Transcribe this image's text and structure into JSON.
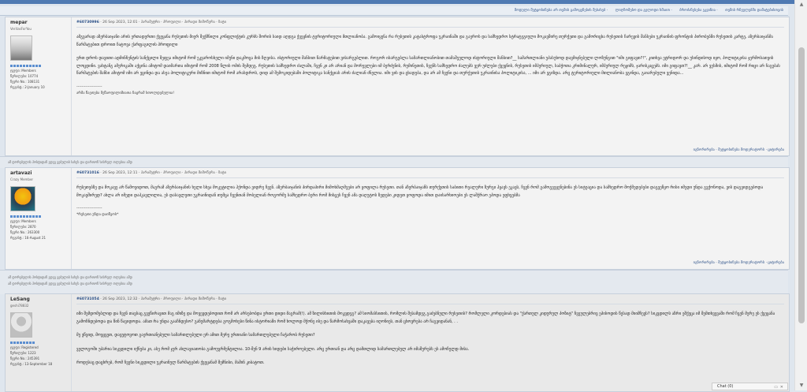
{
  "toplinks": [
    "მოდული შეტყობინება არ თემის გამოყენების შესახებ",
    "ლიღზომებო და გელოდი ხმაით",
    "ბროძანესება ეკვინია",
    "თემის რჩეულებში დამატებისთვის"
  ],
  "posts": [
    {
      "username": "mepar",
      "user_title": "VeritasForYou",
      "stats": [
        "ჯგუფი: Members",
        "წერილები: 10774",
        "წევრი No.: 108131",
        "რეგისტ.: 2-January 10"
      ],
      "header_id": "#60730996",
      "header_rest": " · 26 Sep 2023, 12:01 · პარამეტრი · პროფილი · პირადი მიმოწერა · ზატი",
      "paragraphs": [
        "ამგვარად აზერბაიჯანი არის ერთადერთი ქვეყანა რუსეთის მიერ შექმნილი კონფლიქტის კურსს შორის საიდ აღდგა ქვეყნის ტერიტორიული მთლიანობა. გამოიყენა რა რუსეთის კატასტროფა უკრაინაში და გაეროს და სამხედრო სტრატეგიული მოკავშირე თურქეთი და გამორიცხა რუსეთის ჩარევის შანსები უკრაინის ფრონტის პირობებში რუსეთის კარტე, აზერბაიჯანმა წარმატებით დროით ჩატოვა ქარფაგილის პროფილი",
        "ერთ დროს დავითი ადმინჩენტის სანქცილი შეფეა იმიტომ რომ ეკვაროსხელი იმენი დაკმოცა მის ზღვისა. ისტორიული შანსით წარმატებით ვისარგებლით. როგორ ისარგებლა სამართლიანობით თამაშეულოდ ისტორიული შანსით?__ სამართლიანი უპასუხოდ დავმიჯნებული ლოზუნგით \"იმი გიფავთ?!\", კითხვა ეტრიდორ და უსინდისოდ იყო, პოლიტიკისა ჯერმოსათვის ლოცდინი. ვახტანგ ამერიკაში აქცინა ამიტომ დაიმართა იმიტომ რომ 2008 წლის ომის შემდეგ. რუსეთის სამხედრო ძალაში, ჩვენ კი არ არიან და მორევლები იმ ბერძენის, რუმინეთის, ჩვენს სამხედრო ძალებს ვერ უძლები ქვეყნის, რუსეთის იმპერიულ, საბჭოთა კრიმინალურ, იმპერიულ რეჟიმს, ჯარისკაცებს. იმი გიფავთ?!__ კარ. არ ვესმის, იმიტომ რომ რიცი არ ჩაგებას წარმატების შანსი ამიტომ იმი არ ეცინდა და ასეა პოლიტიკური მიზნით იმიტომ რომ არასდროს, დიდ ამ შემოკიდებაში პოლიტიკა სანქციას არის ძალიან ძნელია. იმი ვის და ცხადება, და არ ამ ჩვენი და თურქეთის უკრაინისა პოლიტიკისა, ... იმი არ ვგიზდა. არც ტერიტორიული მთლიანობა ვგინდა, გაიარებული ვენიდა..."
      ],
      "sig_dashes": "--------------------",
      "signature": "არმა წაეთება მეწაოფილიმიათა ჩაცრამ სთოლდებულია!",
      "footer": [
        "იგნორირება",
        "შეტყობინება მოდერატორს",
        "ციტირება"
      ]
    },
    {
      "username": "artavazi",
      "user_title": "Crazy Member",
      "stats": [
        "ჯგუფი: Members",
        "წერილები: 2870",
        "წევრი No.: 263300",
        "რეგისტ.: 16-August 21"
      ],
      "header_id": "#60731016",
      "header_rest": " · 26 Sep 2023, 12:11 · პარამეტრი · პროფილი · პირადი მიმოწერა · ზატი",
      "paragraphs": [
        "რუსეთებზე და მოკავე არ წამოვიდოთ, მაგრამ აზერბაიჯანის ხელი სხვა მოკეტილია ჰქონდა ვიდრე ჩვენ. აზერბაიჯანის პირდაპირი მიმოხმაღმეები არ ყოფილა რუსეთი. თან აზერბაიჯანს თურქეთის საბითი რეალური ზურგი ჰყავს ეკავს, ჩვენ რომ გამოგვეყენებინა ეს სიტუაცია და სამხედრო მოქმედებები დაგვეწყო რისი იმედი უნდა გვქონოდა, ვის დაგვიდგებოდა მოკავშირედ? ახლა არ იმედი დაპკავლილია, ეს დასავლეთი უკრაინიდან თუმცა ჩვენთან მობელიან როგორმე სამხედრო ბერი რომ მისცეს ჩვენ ამა დაღუტოს ზედები კიდეთ ყოფოდა იმით დაისარხიოები ეს ლაშქრაო ეპოდა ეფხვებმა"
      ],
      "sig_dashes": "--------------------",
      "signature": "*რუსეთი უნდა დაიწვოს*",
      "footer": [
        "იგნორირება",
        "შეტყობინება მოდერატორს",
        "ციტირება"
      ]
    },
    {
      "username": "LeSang",
      "user_title": "geshi78832",
      "stats": [
        "ჯგუფი: Registered",
        "წერილები: 1223",
        "წევრი No.: 245391",
        "რეგისტ.: 13-September 18"
      ],
      "header_id": "#60731054",
      "header_rest": " · 26 Sep 2023, 12:32 · პარამეტრი · პროფილი · პირადი მიმოწერა · ზატი",
      "paragraphs": [
        "იმი შემდომებლიდ და ჩვენ თავსაც გვეწირავით მაგ იმიზე და მოვევდებოდით რომ არ არსებობდა ერთი დიდი მაგრამ(!). ამ ზილისხითის მოკვდეგ? ამ სიომასსითის, რომლის შესამდეგ გაძებნული რუსეთის? რომლელი კორდებიას და \"ქართულ კიდურულ პოზიტ\" ჩვეულებრივ ეპისოდის წესად მიიმჩევს? სიკვდილს აზრი ეშქეცა იმ შემთხვევაში რომ ჩვენ მერე ეს ქვეყანა გამოჩნდებოდა და წინ წავიდოდა. ამათ რა უნდა გააჩნდესო? განუმარტდება გოგმოხესი წინა ისტორიაში რომ ხოლოდ მქონე ისე და წარმოსახვაში დაკავება იღონიეს, თან ცხოვრება არ ჩაგვიდანან, . .",
        "მე ვწვიდ, მოვყვეთ, დავუტოვოთ გაერთიანებული სამართლებული ერ ამით მერე ერთიანი სამართლებული ჩაჭარობ რუსეთი?",
        "ველოგოში უპარია სიკვდილი იქნება კი, ასე რომ ჯერ ახლავიათობა გამოუვრმენტილია. 10-შენ 9 არის ხიდები საჭიროებელი. არც ერთიან და არც დამთლიდ სამართლებულ არ იმაშურებს ეს ამოჩულდ მისა.",
        "როდესაც დაცხრებ, რომ ჩვენი სიკვდილი უკრაინულ წარმატების ქვეყანამ შემნისი, მაშინ კიბატოთ."
      ],
      "sig_dashes": "",
      "signature": "",
      "footer": []
    }
  ],
  "separator_text": "ამ დორებულის პოსტიდან ვდევ ვებულის სახეს და დართონ სისრულ თლებია ამდ",
  "chat": {
    "label": "Chat (0)"
  },
  "colors": {
    "accent": "#4f7ab3",
    "link": "#2a4f87",
    "rep": "#5b8ed0"
  }
}
